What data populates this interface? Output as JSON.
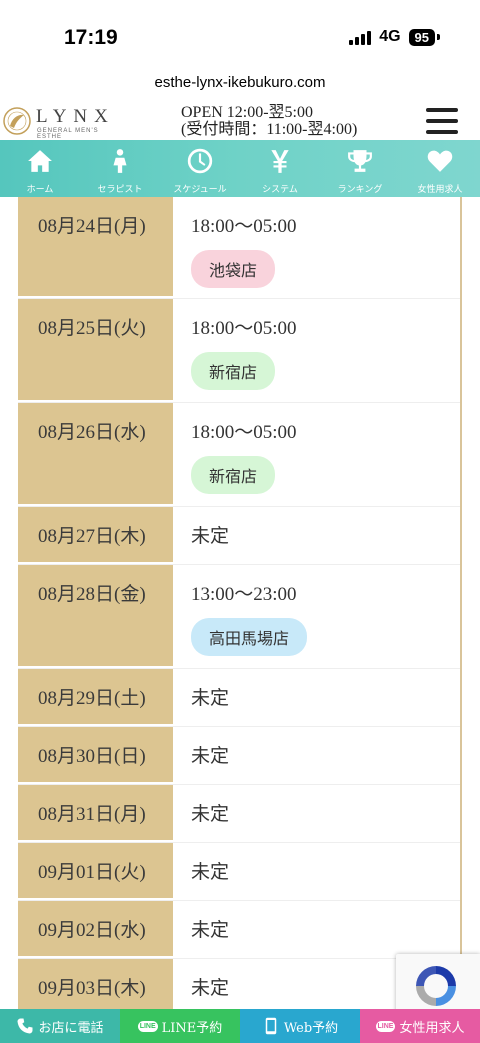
{
  "status_bar": {
    "time": "17:19",
    "network": "4G",
    "battery": "95"
  },
  "browser": {
    "url": "esthe-lynx-ikebukuro.com"
  },
  "header": {
    "logo_text": "LYNX",
    "logo_sub": "GENERAL MEN'S ESTHE",
    "hours_line1": "OPEN 12:00-翌5:00",
    "hours_line2": "(受付時間：11:00-翌4:00)"
  },
  "nav": {
    "items": [
      {
        "label": "ホーム",
        "icon": "home-icon"
      },
      {
        "label": "セラピスト",
        "icon": "person-icon"
      },
      {
        "label": "スケジュール",
        "icon": "clock-icon"
      },
      {
        "label": "システム",
        "icon": "yen-icon"
      },
      {
        "label": "ランキング",
        "icon": "trophy-icon"
      },
      {
        "label": "女性用求人",
        "icon": "heart-icon"
      }
    ]
  },
  "schedule": {
    "rows": [
      {
        "date": "08月24日(月)",
        "time": "18:00～05:00",
        "store": "池袋店",
        "store_color": "pink"
      },
      {
        "date": "08月25日(火)",
        "time": "18:00～05:00",
        "store": "新宿店",
        "store_color": "green"
      },
      {
        "date": "08月26日(水)",
        "time": "18:00～05:00",
        "store": "新宿店",
        "store_color": "green"
      },
      {
        "date": "08月27日(木)",
        "time": "未定"
      },
      {
        "date": "08月28日(金)",
        "time": "13:00～23:00",
        "store": "高田馬場店",
        "store_color": "blue"
      },
      {
        "date": "08月29日(土)",
        "time": "未定"
      },
      {
        "date": "08月30日(日)",
        "time": "未定"
      },
      {
        "date": "08月31日(月)",
        "time": "未定"
      },
      {
        "date": "09月01日(火)",
        "time": "未定"
      },
      {
        "date": "09月02日(水)",
        "time": "未定"
      },
      {
        "date": "09月03日(木)",
        "time": "未定"
      }
    ]
  },
  "bottom_bar": {
    "call": "お店に電話",
    "line_reserve": "LINE予約",
    "web_reserve": "Web予約",
    "recruit": "女性用求人",
    "line_badge": "LINE"
  },
  "colors": {
    "nav_bg": "#6fd2c7",
    "date_bg": "#dcc591",
    "badge_pink": "#f9d3dc",
    "badge_green": "#d6f6d6",
    "badge_blue": "#c8e9f9"
  }
}
